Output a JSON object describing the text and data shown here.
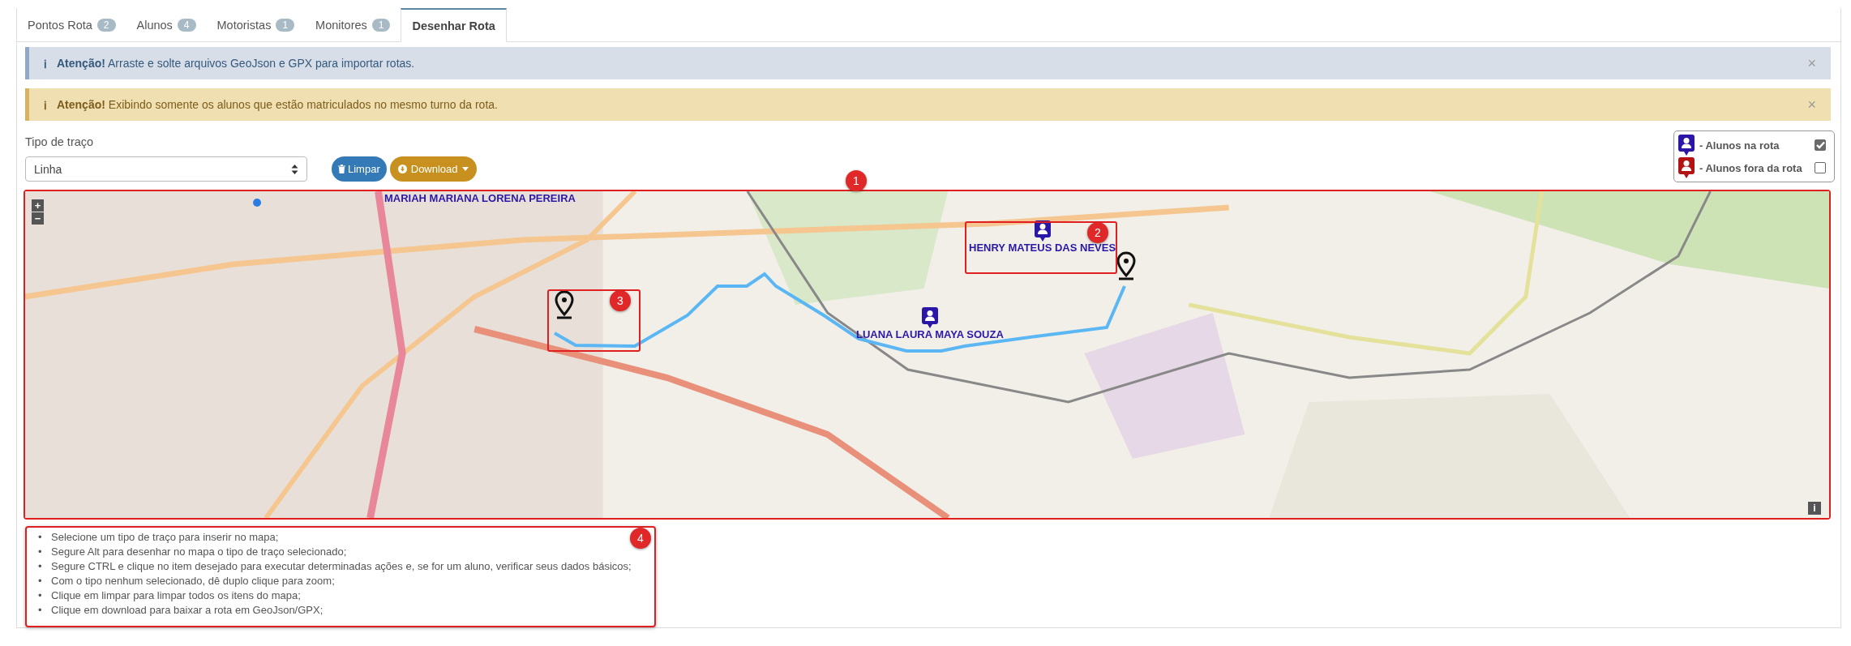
{
  "tabs": [
    {
      "label": "Pontos Rota",
      "count": "2",
      "selected": false
    },
    {
      "label": "Alunos",
      "count": "4",
      "selected": false
    },
    {
      "label": "Motoristas",
      "count": "1",
      "selected": false
    },
    {
      "label": "Monitores",
      "count": "1",
      "selected": false
    },
    {
      "label": "Desenhar Rota",
      "selected": true
    }
  ],
  "alerts": [
    {
      "kind": "info",
      "icon": "ℹ",
      "title": "Atenção!",
      "text": "Arraste e solte arquivos GeoJson e GPX para importar rotas.",
      "close": "×"
    },
    {
      "kind": "warning",
      "icon": "ℹ",
      "title": "Atenção!",
      "text": "Exibindo somente os alunos que estão matriculados no mesmo turno da rota.",
      "close": "×"
    }
  ],
  "trace_type": {
    "label": "Tipo de traço",
    "value": "Linha"
  },
  "buttons": [
    {
      "kind": "clear",
      "label": "Limpar"
    },
    {
      "kind": "download",
      "label": "Download"
    }
  ],
  "legend": [
    {
      "label": "- Alunos na rota",
      "color": "#2a17a8",
      "checked": true
    },
    {
      "label": "- Alunos fora da rota",
      "color": "#b31313",
      "checked": false
    }
  ],
  "map": {
    "zoom_in": "+",
    "zoom_out": "−",
    "info": "i",
    "markers": [
      {
        "kind": "label",
        "name": "MARIAH MARIANA LORENA PEREIRA"
      },
      {
        "kind": "student",
        "name": "HENRY MATEUS DAS NEVES"
      },
      {
        "kind": "student",
        "name": "LUANA LAURA MAYA SOUZA"
      },
      {
        "kind": "pin"
      },
      {
        "kind": "pin"
      }
    ]
  },
  "annotations": [
    "1",
    "2",
    "3",
    "4"
  ],
  "instructions": {
    "bullet": "•",
    "items": [
      "Selecione um tipo de traço para inserir no mapa;",
      "Segure Alt para desenhar no mapa o tipo de traço selecionado;",
      "Segure CTRL e clique no item desejado para executar determinadas ações e, se for um aluno, verificar seus dados básicos;",
      "Com o tipo nenhum selecionado, dê duplo clique para zoom;",
      "Clique em limpar para limpar todos os itens do mapa;",
      "Clique em download para baixar a rota em GeoJson/GPX;"
    ]
  }
}
